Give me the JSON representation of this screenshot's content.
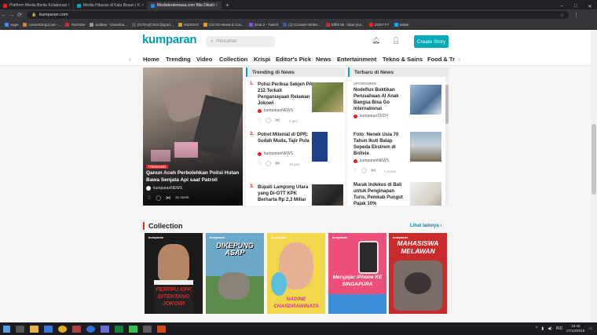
{
  "browser": {
    "tabs": [
      {
        "title": "Platform Media Berita Kolaborasi",
        "color": "#e02626",
        "active": false
      },
      {
        "title": "Media Hiburan di Kala Bosan | K",
        "color": "#00a9b9",
        "active": false
      },
      {
        "title": "Mediaterdemasa.com Bila Dikaiti",
        "color": "#2b7de9",
        "active": true
      }
    ],
    "url": "kumparan.com",
    "bookmarks": [
      {
        "label": "Apps",
        "color": "#4a8af4"
      },
      {
        "label": "convert2mp3.net -...",
        "color": "#e67e22"
      },
      {
        "label": "YouTube",
        "color": "#e02626"
      },
      {
        "label": "andkey - Downloa...",
        "color": "#999"
      },
      {
        "label": "DOTA2[CSGO]Sport...",
        "color": "#555"
      },
      {
        "label": "INDOXXI",
        "color": "#d4a017"
      },
      {
        "label": "CS:GO News & Cov...",
        "color": "#f39c12"
      },
      {
        "label": "Dota 2 - Twitch",
        "color": "#9146ff"
      },
      {
        "label": "(1) Counter-Strike:...",
        "color": "#3b5998"
      },
      {
        "label": "Eiffel 65 - Blue (Ka...",
        "color": "#e02626"
      },
      {
        "label": "ZOEYYY",
        "color": "#e02626"
      },
      {
        "label": "twitter",
        "color": "#1da1f2"
      }
    ]
  },
  "header": {
    "logo": "kumparan",
    "search_placeholder": "Pencarian",
    "create_label": "Create Story"
  },
  "categories": [
    "Home",
    "Trending",
    "Video",
    "Collection",
    "Krispi",
    "Editor's Pick",
    "News",
    "Entertainment",
    "Tekno & Sains",
    "Food & Tr"
  ],
  "hero": {
    "badge": "TRENDING",
    "title": "Qanun Aceh Perbolehkan Polisi Hutan Bawa Senjata Api saat Patroli",
    "source": "kumparanNEWS",
    "time": "31 menit"
  },
  "trending": {
    "heading": "Trending di News",
    "items": [
      {
        "num": "1.",
        "title": "Polisi Periksa Sekjen PA 212 Terkait Penganiayaan Relawan Jokowi",
        "source": "kumparanNEWS",
        "time": "8 jam"
      },
      {
        "num": "2.",
        "title": "Potret Milenial di DPR: Sudah Muda, Tajir Pula",
        "source": "kumparanNEWS",
        "time": "16 jam"
      },
      {
        "num": "3.",
        "title": "Bupati Lampung Utara yang Di-OTT KPK Berharta Rp 2,3 Miliar",
        "source": "",
        "time": ""
      }
    ]
  },
  "terbaru": {
    "heading": "Terbaru di News",
    "items": [
      {
        "sponsor": "SPONSORED",
        "title": "Nodeflux Buktikan Perusahaan AI Anak Bangsa Bisa Go International",
        "source": "kumparanTECH",
        "time": ""
      },
      {
        "sponsor": "",
        "title": "Foto: Nenek Usia 70 Tahun Ikuti Balap Sepeda Ekstrem di Bolivia",
        "source": "kumparanNEWS",
        "time": "1 menit"
      },
      {
        "sponsor": "",
        "title": "Marak Indekos di Bali untuk Penginapan Turis, Pemkab Pungut Pajak 10%",
        "source": "",
        "time": ""
      }
    ]
  },
  "collection": {
    "heading": "Collection",
    "more": "Lihat lainnya",
    "cards": [
      {
        "title": "PERPPU KPK DITENTANG JOKOWI",
        "bg": "#1b1b1b",
        "fg": "#e02626"
      },
      {
        "title": "DIKEPUNG ASAP",
        "bg": "#3fa9c9",
        "fg": "#ffffff"
      },
      {
        "title": "NADINE CHANDRAWINATA",
        "bg": "#f2d64b",
        "fg": "#d33c8a"
      },
      {
        "title": "Mengejar iPhone KE SINGAPURA",
        "bg": "#ec4f7a",
        "fg": "#ffffff"
      },
      {
        "title": "MAHASISWA MELAWAN",
        "bg": "#c92a2a",
        "fg": "#ffffff"
      }
    ],
    "card_brand": "kumparan"
  },
  "taskbar": {
    "lang": "IND",
    "time": "15:48",
    "date": "27/10/2019"
  }
}
